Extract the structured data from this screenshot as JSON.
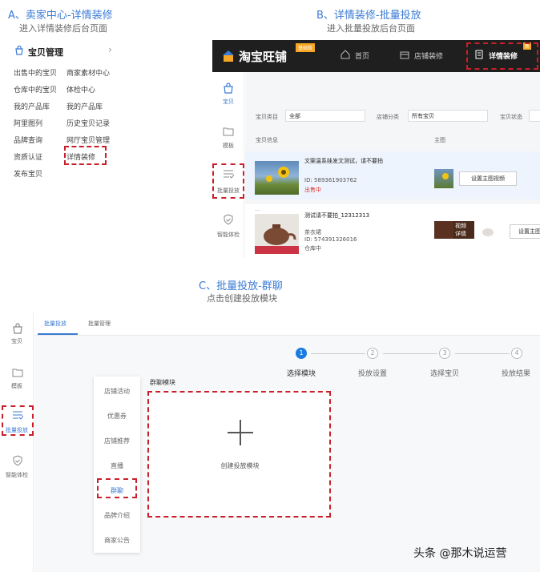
{
  "panel_a": {
    "title": "A、卖家中心-详情装修",
    "subtitle": "进入详情装修后台页面",
    "menu_header": "宝贝管理",
    "chevron": "›",
    "items_col1": [
      "出售中的宝贝",
      "仓库中的宝贝",
      "我的产品库",
      "阿里图列",
      "品牌查询",
      "资质认证",
      "发布宝贝"
    ],
    "items_col2": [
      "商家素材中心",
      "体检中心",
      "我的产品库",
      "历史宝贝记录",
      "网厅宝贝管理",
      "详情装修"
    ]
  },
  "panel_b": {
    "title": "B、详情装修-批量投放",
    "subtitle": "进入批量投放后台页面",
    "logo": "淘宝旺铺",
    "logo_badge": "基础版",
    "nav": [
      "首页",
      "店铺装修",
      "详情装修"
    ],
    "nav_badge": "新",
    "side": [
      "宝贝",
      "模板",
      "批量投放",
      "智能体检"
    ],
    "filters": {
      "category_label": "宝贝类目",
      "category_value": "全部",
      "shop_category_label": "店铺分类",
      "shop_category_value": "所有宝贝",
      "status_label": "宝贝状态"
    },
    "columns": [
      "宝贝信息",
      "主图"
    ],
    "products": [
      {
        "title": "文案温系娃发文测试，请不要拍",
        "id": "ID: 589361903762",
        "status": "出售中",
        "action": "设置主图视频"
      },
      {
        "dots": "...",
        "title": "测试请不要拍_12312313",
        "shop": "茶衣裙",
        "id": "ID: 574391326016",
        "status": "仓库中",
        "video_badge": "视频\n详情",
        "action": "设置主图"
      }
    ]
  },
  "panel_c": {
    "title": "C、批量投放-群聊",
    "subtitle": "点击创建投放模块",
    "tabs": [
      "批量投放",
      "批量管理"
    ],
    "side": [
      "宝贝",
      "模板",
      "批量投放",
      "智能体检"
    ],
    "steps": [
      {
        "num": "1",
        "label": "选择模块"
      },
      {
        "num": "2",
        "label": "投放设置"
      },
      {
        "num": "3",
        "label": "选择宝贝"
      },
      {
        "num": "4",
        "label": "投放结果"
      }
    ],
    "module_title": "群聊模块",
    "menu": [
      "店铺活动",
      "优惠券",
      "店铺推荐",
      "直播",
      "群聊",
      "品牌介绍",
      "商家公告"
    ],
    "create_label": "创建投放模块",
    "plus": "+"
  },
  "watermark": "头条 @那木说运营",
  "colors": {
    "accent": "#3a7bd5",
    "highlight": "#c8202a",
    "topbar": "#1f1f1f",
    "step_active": "#1a7ce0"
  }
}
